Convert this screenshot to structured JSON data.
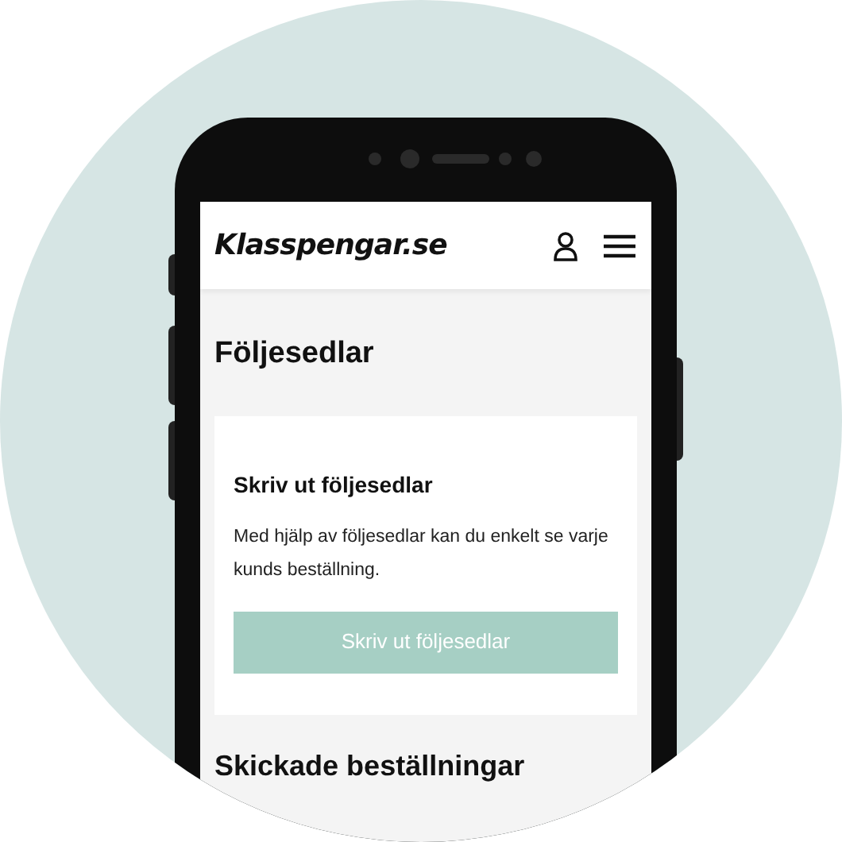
{
  "header": {
    "logo": "Klasspengar.se"
  },
  "page_title": "Följesedlar",
  "card": {
    "title": "Skriv ut följesedlar",
    "text": "Med hjälp av följesedlar kan du enkelt se varje kunds beställning.",
    "button": "Skriv ut följesedlar"
  },
  "section_title": "Skickade beställningar"
}
